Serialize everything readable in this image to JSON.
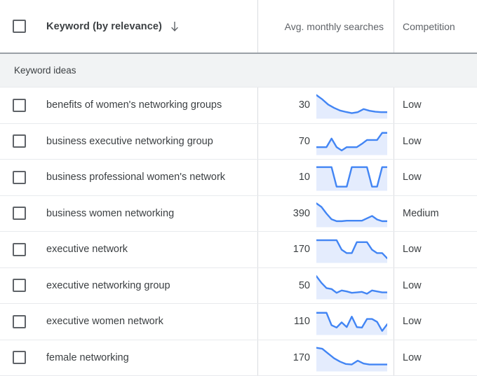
{
  "table": {
    "columns": {
      "keyword": "Keyword (by relevance)",
      "volume": "Avg. monthly searches",
      "competition": "Competition"
    },
    "sort_icon": "arrow-down-icon",
    "group_label": "Keyword ideas",
    "rows": [
      {
        "keyword": "benefits of women's networking groups",
        "volume": "30",
        "competition": "Low",
        "trend": [
          92,
          74,
          52,
          38,
          27,
          21,
          16,
          20,
          33,
          26,
          22,
          20,
          20
        ]
      },
      {
        "keyword": "business executive networking group",
        "volume": "70",
        "competition": "Low",
        "trend": [
          26,
          26,
          26,
          62,
          26,
          12,
          26,
          26,
          26,
          40,
          56,
          56,
          56,
          86,
          86
        ]
      },
      {
        "keyword": "business professional women's network",
        "volume": "10",
        "competition": "Low",
        "trend": [
          92,
          92,
          92,
          92,
          10,
          10,
          10,
          92,
          92,
          92,
          92,
          10,
          10,
          92,
          92
        ]
      },
      {
        "keyword": "business women networking",
        "volume": "390",
        "competition": "Medium",
        "trend": [
          93,
          78,
          50,
          26,
          18,
          18,
          20,
          20,
          20,
          20,
          30,
          40,
          25,
          18,
          18
        ]
      },
      {
        "keyword": "executive network",
        "volume": "170",
        "competition": "Low",
        "trend": [
          88,
          88,
          88,
          88,
          88,
          48,
          34,
          34,
          80,
          80,
          80,
          48,
          34,
          34,
          12
        ]
      },
      {
        "keyword": "executive networking group",
        "volume": "50",
        "competition": "Low",
        "trend": [
          90,
          62,
          40,
          36,
          20,
          30,
          26,
          20,
          22,
          24,
          16,
          30,
          26,
          22,
          22
        ]
      },
      {
        "keyword": "executive women network",
        "volume": "110",
        "competition": "Low",
        "trend": [
          86,
          86,
          86,
          34,
          24,
          46,
          26,
          70,
          26,
          24,
          60,
          60,
          48,
          10,
          38
        ]
      },
      {
        "keyword": "female networking",
        "volume": "170",
        "competition": "Low",
        "trend": [
          92,
          88,
          68,
          48,
          34,
          24,
          22,
          38,
          26,
          22,
          22,
          22,
          22
        ]
      }
    ],
    "colors": {
      "line": "#4285f4",
      "fill": "#e4ecfd",
      "group_band": "#f1f3f4",
      "border": "#e8eaed"
    }
  }
}
